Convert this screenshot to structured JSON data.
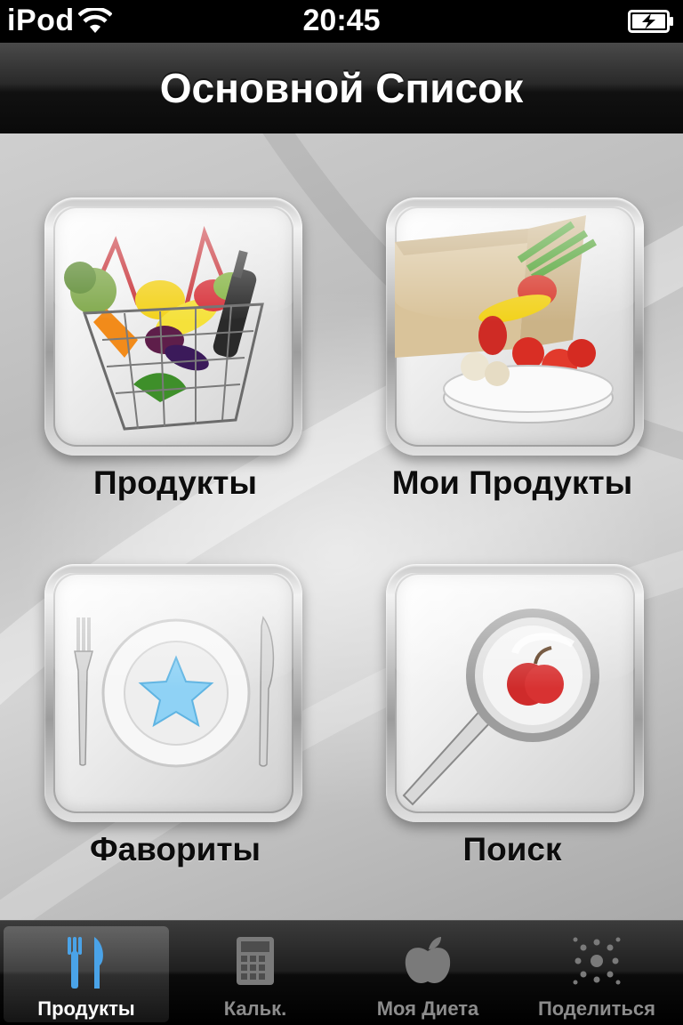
{
  "status": {
    "carrier": "iPod",
    "time": "20:45"
  },
  "navbar": {
    "title": "Основной Список"
  },
  "grid": [
    {
      "label": "Продукты",
      "icon": "grocery-basket-icon"
    },
    {
      "label": "Мои Продукты",
      "icon": "paper-bag-vegetables-icon"
    },
    {
      "label": "Фавориты",
      "icon": "plate-star-cutlery-icon"
    },
    {
      "label": "Поиск",
      "icon": "magnifier-apple-icon"
    }
  ],
  "tabs": [
    {
      "label": "Продукты",
      "icon": "fork-knife-icon",
      "active": true
    },
    {
      "label": "Кальк.",
      "icon": "calculator-icon",
      "active": false
    },
    {
      "label": "Моя Диета",
      "icon": "apple-icon",
      "active": false
    },
    {
      "label": "Поделиться",
      "icon": "share-dots-icon",
      "active": false
    }
  ],
  "colors": {
    "tab_active_icon": "#4aa3e8",
    "tab_inactive": "#8c8c8c",
    "navbar": "#1a1a1a"
  }
}
